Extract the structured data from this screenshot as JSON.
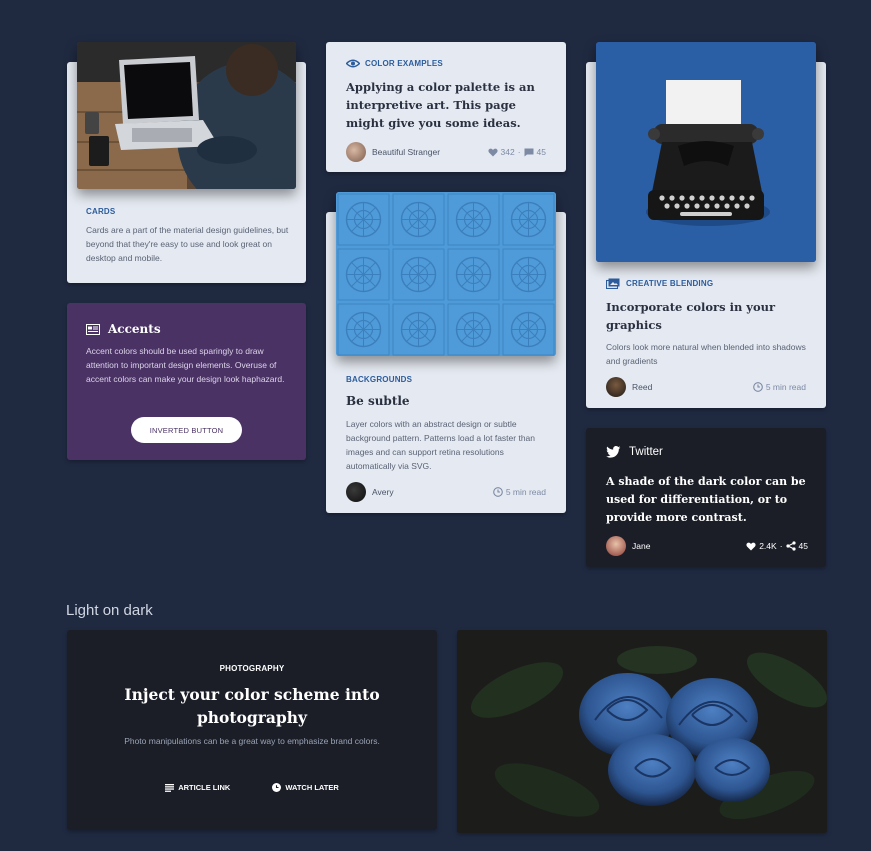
{
  "cards_card": {
    "label": "CARDS",
    "body": "Cards are a part of the material design guidelines, but beyond that they're easy to use and look great on desktop and mobile."
  },
  "accents_card": {
    "title": "Accents",
    "body": "Accent colors should be used sparingly to draw attention to important design elements. Overuse of accent colors can make your design look haphazard.",
    "button_label": "INVERTED BUTTON"
  },
  "color_examples_card": {
    "label": "COLOR EXAMPLES",
    "title": "Applying a color palette is an interpretive art. This page might give you some ideas.",
    "author": "Beautiful Stranger",
    "likes": "342",
    "separator": "·",
    "comments": "45"
  },
  "backgrounds_card": {
    "label": "BACKGROUNDS",
    "title": "Be subtle",
    "body": "Layer colors with an abstract design or subtle background pattern. Patterns load a lot faster than images and can support retina resolutions automatically via SVG.",
    "author": "Avery",
    "read_time": "5 min read"
  },
  "creative_card": {
    "label": "CREATIVE BLENDING",
    "title": "Incorporate colors in your graphics",
    "body": "Colors look more natural when blended into shadows and gradients",
    "author": "Reed",
    "read_time": "5 min read"
  },
  "twitter_card": {
    "title": "Twitter",
    "body": "A shade of the dark color can be used for differentiation, or to provide more contrast.",
    "author": "Jane",
    "likes": "2.4K",
    "separator": "·",
    "shares": "45"
  },
  "section": {
    "title": "Light on dark"
  },
  "photo_card": {
    "label": "PHOTOGRAPHY",
    "title": "Inject your color scheme into photography",
    "body": "Photo manipulations can be a great way to emphasize brand colors.",
    "link_label": "ARTICLE LINK",
    "watch_label": "WATCH LATER"
  },
  "colors": {
    "background": "#1f2940",
    "card_light": "#e5eaf2",
    "accent_purple": "#4a3265",
    "accent_blue": "#2c5c9c",
    "dark_card": "#1b1e27"
  }
}
